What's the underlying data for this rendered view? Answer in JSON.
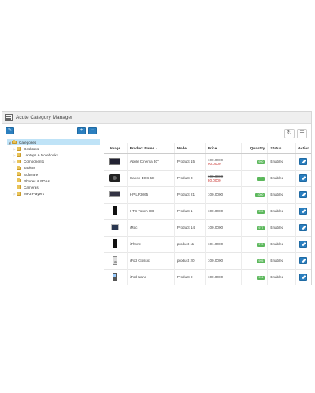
{
  "window": {
    "title": "Acute Category Manager"
  },
  "colors": {
    "accent": "#2b7fbf",
    "selected_row": "#bfe3f7",
    "qty_badge": "#5cb85c",
    "special_price": "#c9302c"
  },
  "icons": {
    "edit": "pencil-icon",
    "expand": "plus-icon",
    "collapse": "minus-icon",
    "refresh": "refresh-icon",
    "columns": "list-icon"
  },
  "tree": {
    "root": "Categories",
    "items": [
      "Desktops",
      "Laptops & Notebooks",
      "Components",
      "Tablets",
      "Software",
      "Phones & PDAs",
      "Cameras",
      "MP3 Players"
    ]
  },
  "table": {
    "headers": [
      "Image",
      "Product Name",
      "Model",
      "Price",
      "Quantity",
      "Status",
      "Action"
    ],
    "rows": [
      {
        "name": "Apple Cinema 30\"",
        "model": "Product 15",
        "price": "100.0000",
        "special": "90.0000",
        "quantity": "990",
        "status": "Enabled"
      },
      {
        "name": "Canon EOS 5D",
        "model": "Product 3",
        "price": "100.0000",
        "special": "80.0000",
        "quantity": "7",
        "status": "Enabled"
      },
      {
        "name": "HP LP3065",
        "model": "Product 21",
        "price": "100.0000",
        "special": "",
        "quantity": "1000",
        "status": "Enabled"
      },
      {
        "name": "HTC Touch HD",
        "model": "Product 1",
        "price": "100.0000",
        "special": "",
        "quantity": "939",
        "status": "Enabled"
      },
      {
        "name": "iMac",
        "model": "Product 14",
        "price": "100.0000",
        "special": "",
        "quantity": "977",
        "status": "Enabled"
      },
      {
        "name": "iPhone",
        "model": "product 11",
        "price": "101.0000",
        "special": "",
        "quantity": "970",
        "status": "Enabled"
      },
      {
        "name": "iPod Classic",
        "model": "product 20",
        "price": "100.0000",
        "special": "",
        "quantity": "995",
        "status": "Enabled"
      },
      {
        "name": "iPod Nano",
        "model": "Product 9",
        "price": "100.0000",
        "special": "",
        "quantity": "994",
        "status": "Enabled"
      }
    ]
  }
}
